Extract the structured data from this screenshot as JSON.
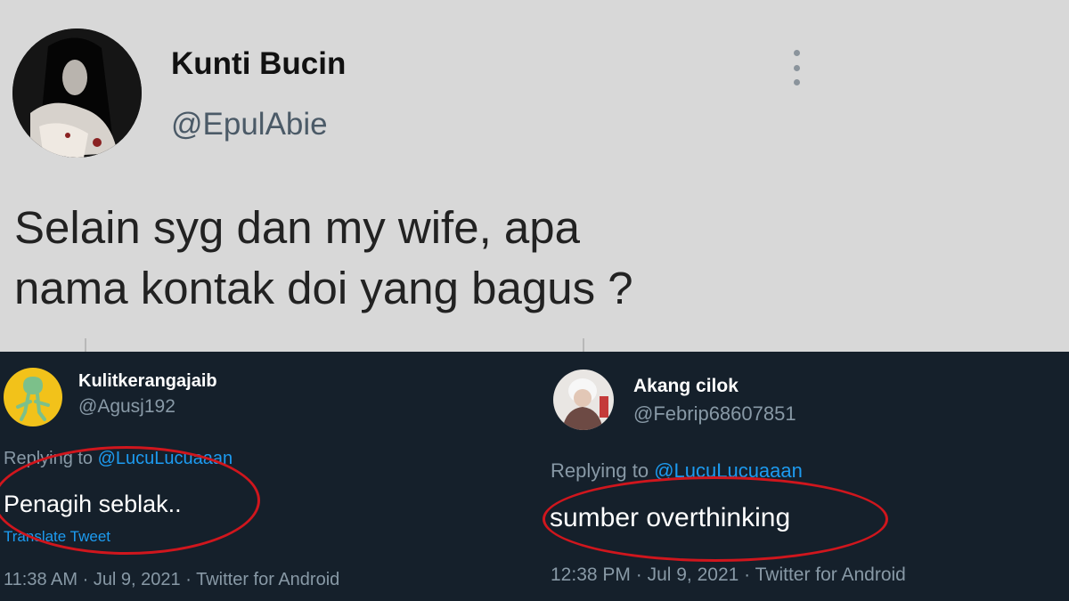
{
  "main_tweet": {
    "name": "Kunti Bucin",
    "handle": "@EpulAbie",
    "text_line1": "Selain syg dan my wife, apa",
    "text_line2": "nama kontak doi yang bagus ?",
    "more_icon": "more-vertical-icon"
  },
  "replies": [
    {
      "name": "Kulitkerangajaib",
      "handle": "@Agusj192",
      "replying_prefix": "Replying to ",
      "replying_to": "@LucuLucuaaan",
      "text": "Penagih seblak..",
      "translate": "Translate Tweet",
      "time": "11:38 AM",
      "date": "Jul 9, 2021",
      "sep": " · ",
      "app": "Twitter for Android"
    },
    {
      "name": "Akang cilok",
      "handle": "@Febrip68607851",
      "replying_prefix": "Replying to ",
      "replying_to": "@LucuLucuaaan",
      "text": "sumber overthinking",
      "time": "12:38 PM",
      "date": "Jul 9, 2021",
      "sep": " · ",
      "app": "Twitter for Android"
    }
  ],
  "colors": {
    "top_bg": "#d8d8d8",
    "dark_bg": "#15202b",
    "link": "#1d9bf0",
    "circle": "#d0161d"
  }
}
